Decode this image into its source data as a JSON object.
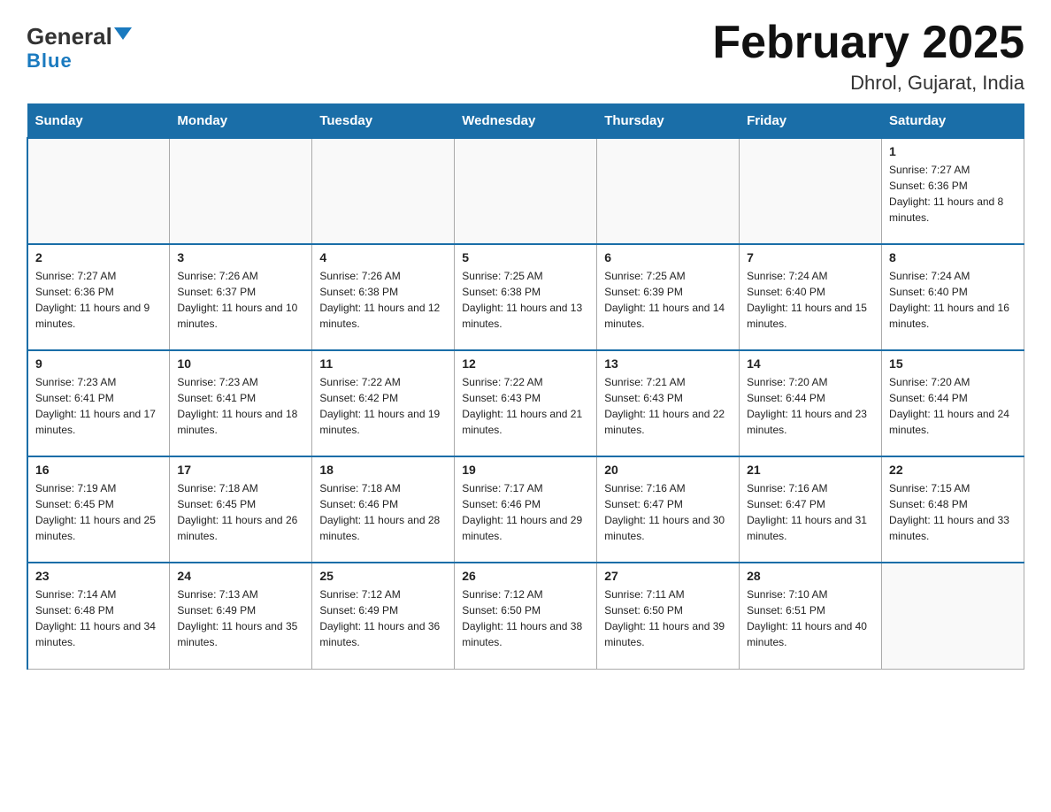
{
  "header": {
    "title": "February 2025",
    "subtitle": "Dhrol, Gujarat, India",
    "logo_general": "General",
    "logo_blue": "Blue"
  },
  "days_of_week": [
    "Sunday",
    "Monday",
    "Tuesday",
    "Wednesday",
    "Thursday",
    "Friday",
    "Saturday"
  ],
  "weeks": [
    [
      {
        "day": "",
        "info": ""
      },
      {
        "day": "",
        "info": ""
      },
      {
        "day": "",
        "info": ""
      },
      {
        "day": "",
        "info": ""
      },
      {
        "day": "",
        "info": ""
      },
      {
        "day": "",
        "info": ""
      },
      {
        "day": "1",
        "info": "Sunrise: 7:27 AM\nSunset: 6:36 PM\nDaylight: 11 hours and 8 minutes."
      }
    ],
    [
      {
        "day": "2",
        "info": "Sunrise: 7:27 AM\nSunset: 6:36 PM\nDaylight: 11 hours and 9 minutes."
      },
      {
        "day": "3",
        "info": "Sunrise: 7:26 AM\nSunset: 6:37 PM\nDaylight: 11 hours and 10 minutes."
      },
      {
        "day": "4",
        "info": "Sunrise: 7:26 AM\nSunset: 6:38 PM\nDaylight: 11 hours and 12 minutes."
      },
      {
        "day": "5",
        "info": "Sunrise: 7:25 AM\nSunset: 6:38 PM\nDaylight: 11 hours and 13 minutes."
      },
      {
        "day": "6",
        "info": "Sunrise: 7:25 AM\nSunset: 6:39 PM\nDaylight: 11 hours and 14 minutes."
      },
      {
        "day": "7",
        "info": "Sunrise: 7:24 AM\nSunset: 6:40 PM\nDaylight: 11 hours and 15 minutes."
      },
      {
        "day": "8",
        "info": "Sunrise: 7:24 AM\nSunset: 6:40 PM\nDaylight: 11 hours and 16 minutes."
      }
    ],
    [
      {
        "day": "9",
        "info": "Sunrise: 7:23 AM\nSunset: 6:41 PM\nDaylight: 11 hours and 17 minutes."
      },
      {
        "day": "10",
        "info": "Sunrise: 7:23 AM\nSunset: 6:41 PM\nDaylight: 11 hours and 18 minutes."
      },
      {
        "day": "11",
        "info": "Sunrise: 7:22 AM\nSunset: 6:42 PM\nDaylight: 11 hours and 19 minutes."
      },
      {
        "day": "12",
        "info": "Sunrise: 7:22 AM\nSunset: 6:43 PM\nDaylight: 11 hours and 21 minutes."
      },
      {
        "day": "13",
        "info": "Sunrise: 7:21 AM\nSunset: 6:43 PM\nDaylight: 11 hours and 22 minutes."
      },
      {
        "day": "14",
        "info": "Sunrise: 7:20 AM\nSunset: 6:44 PM\nDaylight: 11 hours and 23 minutes."
      },
      {
        "day": "15",
        "info": "Sunrise: 7:20 AM\nSunset: 6:44 PM\nDaylight: 11 hours and 24 minutes."
      }
    ],
    [
      {
        "day": "16",
        "info": "Sunrise: 7:19 AM\nSunset: 6:45 PM\nDaylight: 11 hours and 25 minutes."
      },
      {
        "day": "17",
        "info": "Sunrise: 7:18 AM\nSunset: 6:45 PM\nDaylight: 11 hours and 26 minutes."
      },
      {
        "day": "18",
        "info": "Sunrise: 7:18 AM\nSunset: 6:46 PM\nDaylight: 11 hours and 28 minutes."
      },
      {
        "day": "19",
        "info": "Sunrise: 7:17 AM\nSunset: 6:46 PM\nDaylight: 11 hours and 29 minutes."
      },
      {
        "day": "20",
        "info": "Sunrise: 7:16 AM\nSunset: 6:47 PM\nDaylight: 11 hours and 30 minutes."
      },
      {
        "day": "21",
        "info": "Sunrise: 7:16 AM\nSunset: 6:47 PM\nDaylight: 11 hours and 31 minutes."
      },
      {
        "day": "22",
        "info": "Sunrise: 7:15 AM\nSunset: 6:48 PM\nDaylight: 11 hours and 33 minutes."
      }
    ],
    [
      {
        "day": "23",
        "info": "Sunrise: 7:14 AM\nSunset: 6:48 PM\nDaylight: 11 hours and 34 minutes."
      },
      {
        "day": "24",
        "info": "Sunrise: 7:13 AM\nSunset: 6:49 PM\nDaylight: 11 hours and 35 minutes."
      },
      {
        "day": "25",
        "info": "Sunrise: 7:12 AM\nSunset: 6:49 PM\nDaylight: 11 hours and 36 minutes."
      },
      {
        "day": "26",
        "info": "Sunrise: 7:12 AM\nSunset: 6:50 PM\nDaylight: 11 hours and 38 minutes."
      },
      {
        "day": "27",
        "info": "Sunrise: 7:11 AM\nSunset: 6:50 PM\nDaylight: 11 hours and 39 minutes."
      },
      {
        "day": "28",
        "info": "Sunrise: 7:10 AM\nSunset: 6:51 PM\nDaylight: 11 hours and 40 minutes."
      },
      {
        "day": "",
        "info": ""
      }
    ]
  ]
}
